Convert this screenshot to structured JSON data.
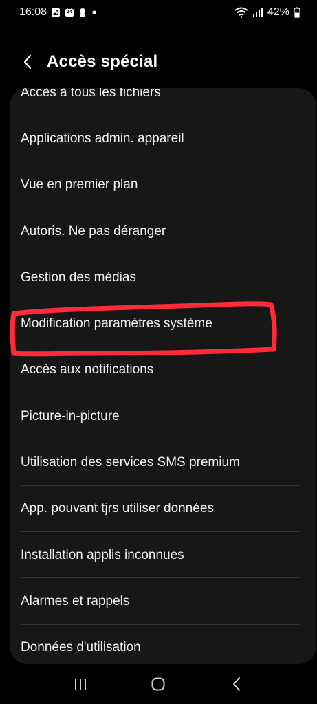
{
  "status_bar": {
    "time": "16:08",
    "notif_icons": [
      "image-icon",
      "calendar-icon",
      "keyhole-icon",
      "dot-icon"
    ],
    "calendar_day": "14",
    "battery": "42%"
  },
  "header": {
    "title": "Accès spécial",
    "back_icon": "chevron-left-icon"
  },
  "list": {
    "items": [
      {
        "label": "Accès à tous les fichiers"
      },
      {
        "label": "Applications admin. appareil"
      },
      {
        "label": "Vue en premier plan"
      },
      {
        "label": "Autoris. Ne pas déranger"
      },
      {
        "label": "Gestion des médias"
      },
      {
        "label": "Modification paramètres système"
      },
      {
        "label": "Accès aux notifications"
      },
      {
        "label": "Picture-in-picture"
      },
      {
        "label": "Utilisation des services SMS premium"
      },
      {
        "label": "App. pouvant tjrs utiliser données"
      },
      {
        "label": "Installation applis inconnues"
      },
      {
        "label": "Alarmes et rappels"
      },
      {
        "label": "Données d'utilisation"
      }
    ]
  },
  "annotation": {
    "color": "#ff2a3a",
    "highlighted_item": "Modification paramètres système"
  },
  "nav_bar": {
    "icons": [
      "recent-apps-icon",
      "home-icon",
      "back-icon"
    ]
  },
  "colors": {
    "background": "#000000",
    "card": "#171717",
    "divider": "#333333",
    "text": "#f0f0f0"
  }
}
